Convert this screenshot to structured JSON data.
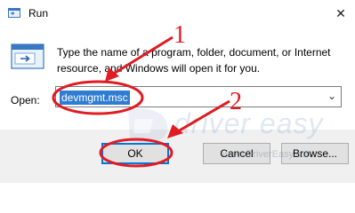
{
  "window": {
    "title": "Run",
    "close_glyph": "✕",
    "app_icon": "run-icon"
  },
  "dialog": {
    "description": "Type the name of a program, folder, document, or Internet resource, and Windows will open it for you.",
    "open_label": "Open:",
    "open_value": "devmgmt.msc",
    "dropdown_glyph": "⌄"
  },
  "buttons": {
    "ok": "OK",
    "cancel": "Cancel",
    "browse": "Browse..."
  },
  "watermark": {
    "brand": "driver easy",
    "url": "www.DriverEasy.com"
  },
  "annotations": {
    "step1": "1",
    "step2": "2",
    "color": "#e01b22"
  }
}
